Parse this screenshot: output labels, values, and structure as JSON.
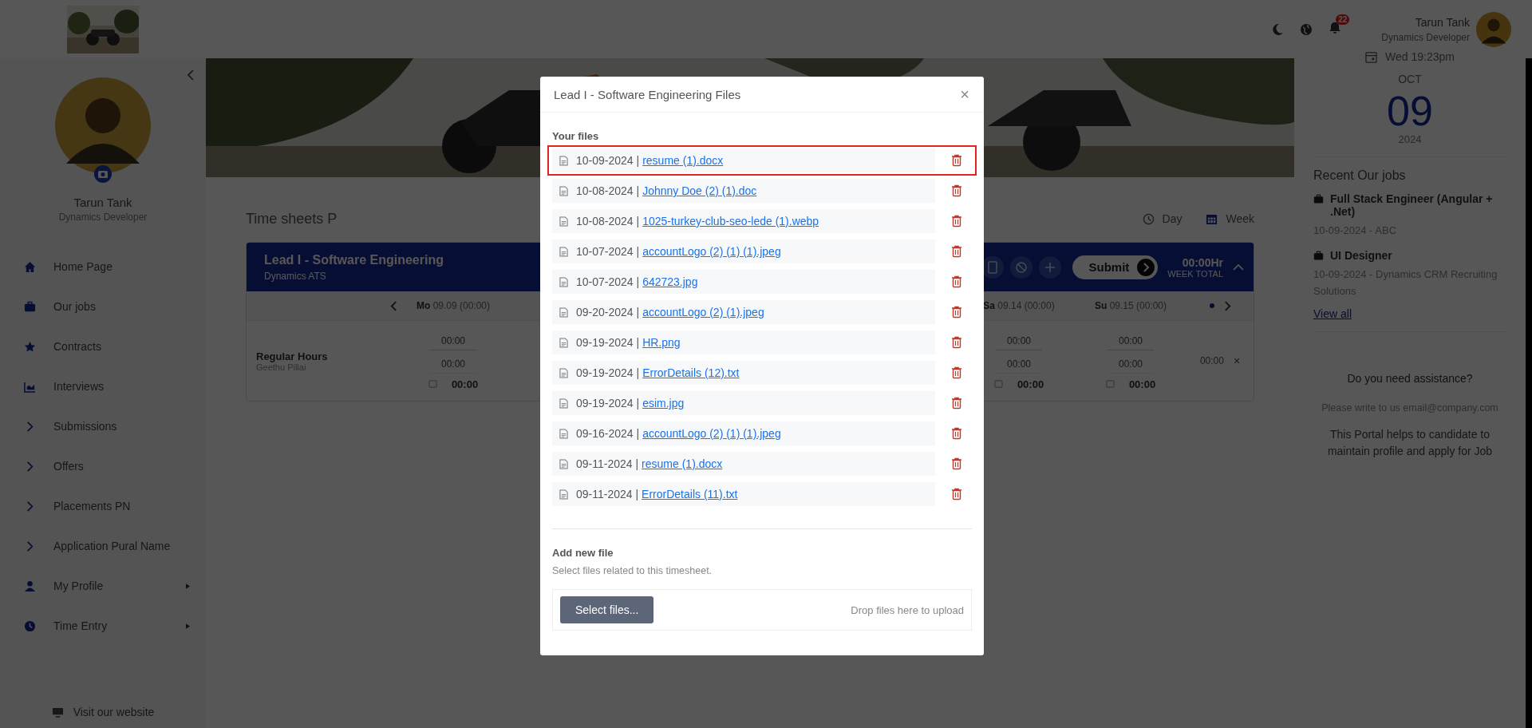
{
  "header": {
    "notifications": "22",
    "user": {
      "name": "Tarun Tank",
      "role": "Dynamics Developer"
    }
  },
  "sidebar": {
    "profile": {
      "name": "Tarun Tank",
      "role": "Dynamics Developer"
    },
    "menu": [
      {
        "label": "Home Page",
        "kind": "home",
        "submenu": false
      },
      {
        "label": "Our jobs",
        "kind": "briefcase",
        "submenu": false
      },
      {
        "label": "Contracts",
        "kind": "star",
        "submenu": false
      },
      {
        "label": "Interviews",
        "kind": "chart",
        "submenu": false
      },
      {
        "label": "Submissions",
        "kind": "chevron",
        "submenu": false
      },
      {
        "label": "Offers",
        "kind": "chevron",
        "submenu": false
      },
      {
        "label": "Placements PN",
        "kind": "chevron",
        "submenu": false
      },
      {
        "label": "Application Pural Name",
        "kind": "chevron",
        "submenu": false
      },
      {
        "label": "My Profile",
        "kind": "user",
        "submenu": true
      },
      {
        "label": "Time Entry",
        "kind": "clock",
        "submenu": true
      }
    ],
    "footer_link": "Visit our website"
  },
  "timesheet": {
    "title": "Time sheets P",
    "views": [
      {
        "label": "Day",
        "kind": "clock"
      },
      {
        "label": "Week",
        "kind": "calendar"
      }
    ],
    "card": {
      "title": "Lead I - Software Engineering",
      "subtitle": "Dynamics ATS",
      "submit": "Submit",
      "total": "00:00Hr",
      "total_label": "WEEK TOTAL",
      "days": [
        {
          "day": "Mo",
          "date": "09.09 (00:00)"
        },
        {
          "day": "Sa",
          "date": "09.14 (00:00)"
        },
        {
          "day": "Su",
          "date": "09.15 (00:00)"
        }
      ],
      "row": {
        "label": "Regular Hours",
        "person": "Geethu Pillai",
        "total": "00:00",
        "remove": "×",
        "cells": [
          {
            "input": "00:00",
            "planned": "00:00",
            "sum": "00:00"
          },
          {
            "input": "00:00",
            "planned": "00:00",
            "sum": "00:00"
          },
          {
            "input": "00:00",
            "planned": "00:00",
            "sum": "00:00"
          }
        ]
      }
    }
  },
  "right_panel": {
    "date": {
      "time": "Wed 19:23pm",
      "month": "OCT",
      "day": "09",
      "year": "2024"
    },
    "recent_jobs": {
      "title": "Recent Our jobs",
      "items": [
        {
          "title": "Full Stack Engineer (Angular + .Net)",
          "meta": "10-09-2024 - ABC"
        },
        {
          "title": "UI Designer",
          "meta": "10-09-2024 - Dynamics CRM Recruiting Solutions"
        }
      ],
      "view_all": "View all"
    },
    "assistance": {
      "title": "Do you need assistance?",
      "contact": "Please write to us email@company.com",
      "note": "This Portal helps to candidate to maintain profile and apply for Job"
    }
  },
  "modal": {
    "title": "Lead I - Software Engineering Files",
    "close": "×",
    "files_heading": "Your files",
    "files": [
      {
        "date": "10-09-2024 |",
        "name": "resume (1).docx",
        "highlighted": true
      },
      {
        "date": "10-08-2024 |",
        "name": "Johnny Doe (2) (1).doc",
        "highlighted": false
      },
      {
        "date": "10-08-2024 |",
        "name": "1025-turkey-club-seo-lede (1).webp",
        "highlighted": false
      },
      {
        "date": "10-07-2024 |",
        "name": "accountLogo (2) (1) (1).jpeg",
        "highlighted": false
      },
      {
        "date": "10-07-2024 |",
        "name": "642723.jpg",
        "highlighted": false
      },
      {
        "date": "09-20-2024 |",
        "name": "accountLogo (2) (1).jpeg",
        "highlighted": false
      },
      {
        "date": "09-19-2024 |",
        "name": "HR.png",
        "highlighted": false
      },
      {
        "date": "09-19-2024 |",
        "name": "ErrorDetails (12).txt",
        "highlighted": false
      },
      {
        "date": "09-19-2024 |",
        "name": "esim.jpg",
        "highlighted": false
      },
      {
        "date": "09-16-2024 |",
        "name": "accountLogo (2) (1) (1).jpeg",
        "highlighted": false
      },
      {
        "date": "09-11-2024 |",
        "name": "resume (1).docx",
        "highlighted": false
      },
      {
        "date": "09-11-2024 |",
        "name": "ErrorDetails (11).txt",
        "highlighted": false
      }
    ],
    "add_heading": "Add new file",
    "add_hint": "Select files related to this timesheet.",
    "select_button": "Select files...",
    "drop_hint": "Drop files here to upload"
  }
}
